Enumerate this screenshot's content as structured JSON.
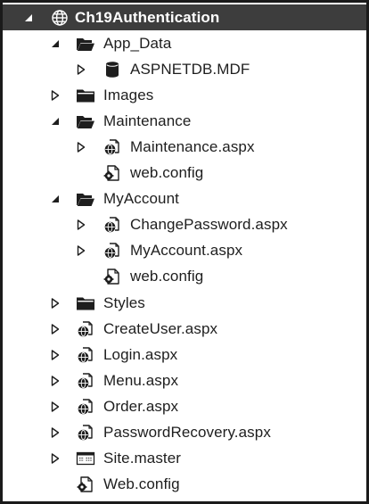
{
  "solution_explorer": {
    "root": {
      "label": "Ch19Authentication",
      "icon": "globe-icon",
      "state": "expanded"
    },
    "items": [
      {
        "label": "App_Data",
        "icon": "folder-open-icon",
        "state": "expanded"
      },
      {
        "label": "ASPNETDB.MDF",
        "icon": "database-icon",
        "state": "collapsed"
      },
      {
        "label": "Images",
        "icon": "folder-icon",
        "state": "collapsed"
      },
      {
        "label": "Maintenance",
        "icon": "folder-open-icon",
        "state": "expanded"
      },
      {
        "label": "Maintenance.aspx",
        "icon": "web-page-icon",
        "state": "collapsed"
      },
      {
        "label": "web.config",
        "icon": "config-file-icon",
        "state": "none"
      },
      {
        "label": "MyAccount",
        "icon": "folder-open-icon",
        "state": "expanded"
      },
      {
        "label": "ChangePassword.aspx",
        "icon": "web-page-icon",
        "state": "collapsed"
      },
      {
        "label": "MyAccount.aspx",
        "icon": "web-page-icon",
        "state": "collapsed"
      },
      {
        "label": "web.config",
        "icon": "config-file-icon",
        "state": "none"
      },
      {
        "label": "Styles",
        "icon": "folder-icon",
        "state": "collapsed"
      },
      {
        "label": "CreateUser.aspx",
        "icon": "web-page-icon",
        "state": "collapsed"
      },
      {
        "label": "Login.aspx",
        "icon": "web-page-icon",
        "state": "collapsed"
      },
      {
        "label": "Menu.aspx",
        "icon": "web-page-icon",
        "state": "collapsed"
      },
      {
        "label": "Order.aspx",
        "icon": "web-page-icon",
        "state": "collapsed"
      },
      {
        "label": "PasswordRecovery.aspx",
        "icon": "web-page-icon",
        "state": "collapsed"
      },
      {
        "label": "Site.master",
        "icon": "master-page-icon",
        "state": "collapsed"
      },
      {
        "label": "Web.config",
        "icon": "config-file-icon",
        "state": "none"
      }
    ]
  },
  "colors": {
    "selected_background": "#3d3d3d",
    "selected_text": "#ffffff",
    "text": "#1e1e1e",
    "icon": "#1e1e1e"
  }
}
